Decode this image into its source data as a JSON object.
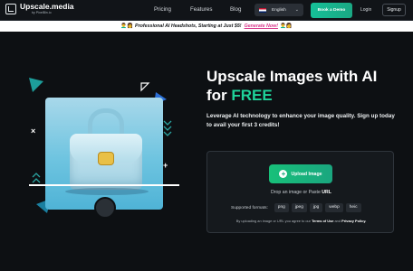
{
  "nav": {
    "logo_title": "Upscale.media",
    "logo_sub": "by PixelBin.io",
    "links": [
      "Pricing",
      "Features",
      "Blog"
    ],
    "language": "English",
    "book_demo": "Book a Demo",
    "login": "Login",
    "signup": "Signup"
  },
  "banner": {
    "emoji_left": "👨‍🦱👩",
    "text": "Professional AI Headshots, Starting at Just $5!",
    "cta": "Generate Now!",
    "emoji_right": "👨‍🦱👩"
  },
  "hero": {
    "title_line1": "Upscale Images with AI",
    "title_for": "for ",
    "title_free": "FREE",
    "subtitle": "Leverage AI technology to enhance your image quality. Sign up today to avail your first 3 credits!"
  },
  "upload": {
    "button": "Upload Image",
    "drop_prefix": "Drop an image or Paste ",
    "drop_url": "URL",
    "formats_label": "Supported formats:",
    "formats": [
      "png",
      "jpeg",
      "jpg",
      "webp",
      "heic"
    ],
    "terms_prefix": "By uploading an image or URL you agree to our ",
    "terms_link": "Terms of Use",
    "terms_and": " and ",
    "privacy_link": "Privacy Policy."
  },
  "colors": {
    "accent_green": "#1fd39a",
    "button_green": "#18c07a",
    "banner_link": "#d7368a",
    "background": "#0d1013"
  }
}
